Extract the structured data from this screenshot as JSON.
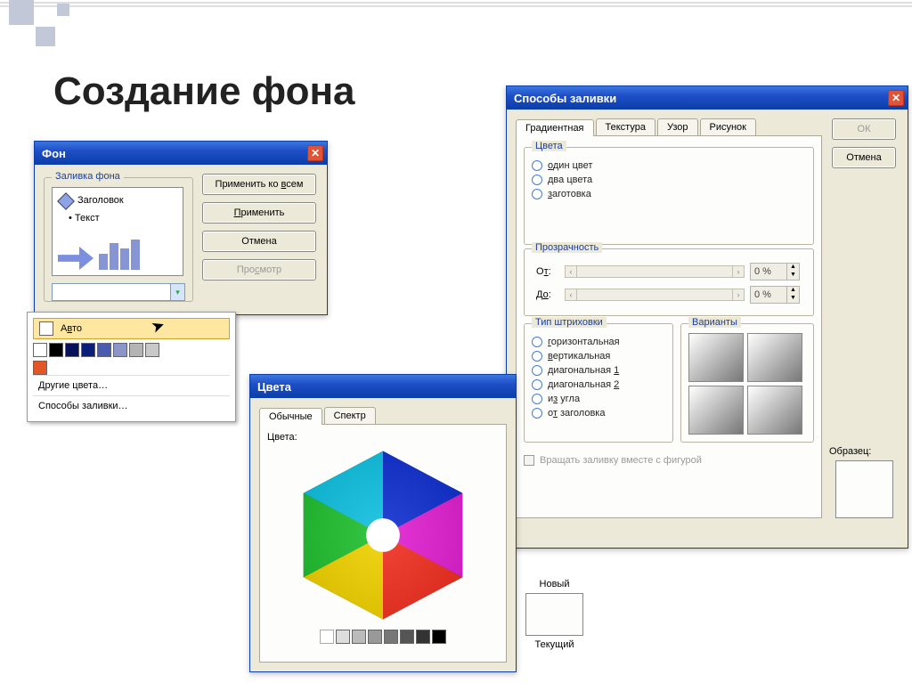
{
  "page": {
    "title": "Создание фона"
  },
  "bgDialog": {
    "title": "Фон",
    "group": "Заливка фона",
    "preview": {
      "heading": "Заголовок",
      "bullet": "Текст"
    },
    "buttons": {
      "applyAll_pre": "Применить ко ",
      "applyAll_u": "в",
      "applyAll_post": "сем",
      "apply_u": "П",
      "apply_post": "рименить",
      "cancel": "Отмена",
      "preview_pre": "Про",
      "preview_u": "с",
      "preview_post": "мотр"
    }
  },
  "colorPopup": {
    "auto_pre": "А",
    "auto_u": "в",
    "auto_post": "то",
    "row1": [
      "#ffffff",
      "#000000",
      "#07125a",
      "#0a1f7a",
      "#4a5cae",
      "#8a95c8",
      "#b4b4b4",
      "#c8c8c8"
    ],
    "row2": [
      "#e35625"
    ],
    "more": "Другие цвета…",
    "fillMethods": "Способы заливки…"
  },
  "colorsDialog": {
    "title": "Цвета",
    "tabs": {
      "standard": "Обычные",
      "spectrum": "Спектр"
    },
    "label": "Цвета:",
    "new": "Новый",
    "current": "Текущий"
  },
  "fillDialog": {
    "title": "Способы заливки",
    "tabs": {
      "gradient": "Градиентная",
      "texture": "Текстура",
      "pattern": "Узор",
      "picture": "Рисунок"
    },
    "okLabel": "ОК",
    "cancelLabel": "Отмена",
    "colorsGroup": "Цвета",
    "oneColor_u": "о",
    "oneColor_post": "дин цвет",
    "twoColors_u": "д",
    "twoColors_post": "ва цвета",
    "preset_u": "з",
    "preset_post": "аготовка",
    "transparencyGroup": "Прозрачность",
    "from_pre": "О",
    "from_u": "т",
    "from_post": ":",
    "to_pre": "Д",
    "to_u": "о",
    "to_post": ":",
    "pct": "0 %",
    "hatchGroup": "Тип штриховки",
    "h_horiz_u": "г",
    "h_horiz_post": "оризонтальная",
    "h_vert_u": "в",
    "h_vert_post": "ертикальная",
    "h_d1": "диагональная ",
    "h_d1_u": "1",
    "h_d2": "диагональная ",
    "h_d2_u": "2",
    "h_corner_pre": "и",
    "h_corner_u": "з",
    "h_corner_post": " угла",
    "h_title_pre": "о",
    "h_title_u": "т",
    "h_title_post": " заголовка",
    "variantsGroup": "Варианты",
    "sampleLabel": "Образец:",
    "rotateFill": "Вращать заливку вместе с фигурой"
  }
}
